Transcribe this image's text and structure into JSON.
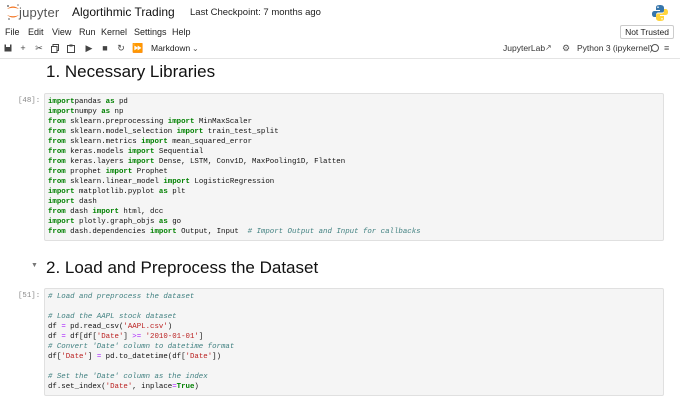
{
  "header": {
    "brand": "jupyter",
    "notebook_title": "Algortihmic Trading",
    "checkpoint": "Last Checkpoint: 7 months ago"
  },
  "menu": {
    "items": [
      "File",
      "Edit",
      "View",
      "Run",
      "Kernel",
      "Settings",
      "Help"
    ],
    "trust_label": "Not Trusted"
  },
  "toolbar": {
    "cell_type": "Markdown",
    "jupyterlab_label": "JupyterLab",
    "kernel_name": "Python 3 (ipykernel)"
  },
  "cells": {
    "heading1": "1. Necessary Libraries",
    "code1_prompt": "[48]:",
    "heading2": "2. Load and Preprocess the Dataset",
    "code2_prompt": "[51]:"
  },
  "code1_lines": [
    [
      [
        "kw",
        "import"
      ],
      [
        "",
        "pandas "
      ],
      [
        "kw",
        "as"
      ],
      [
        "",
        " pd"
      ]
    ],
    [
      [
        "kw",
        "import"
      ],
      [
        "",
        "numpy "
      ],
      [
        "kw",
        "as"
      ],
      [
        "",
        " np"
      ]
    ],
    [
      [
        "kw",
        "from"
      ],
      [
        "",
        " sklearn.preprocessing "
      ],
      [
        "kw",
        "import"
      ],
      [
        "",
        " MinMaxScaler"
      ]
    ],
    [
      [
        "kw",
        "from"
      ],
      [
        "",
        " sklearn.model_selection "
      ],
      [
        "kw",
        "import"
      ],
      [
        "",
        " train_test_split"
      ]
    ],
    [
      [
        "kw",
        "from"
      ],
      [
        "",
        " sklearn.metrics "
      ],
      [
        "kw",
        "import"
      ],
      [
        "",
        " mean_squared_error"
      ]
    ],
    [
      [
        "kw",
        "from"
      ],
      [
        "",
        " keras.models "
      ],
      [
        "kw",
        "import"
      ],
      [
        "",
        " Sequential"
      ]
    ],
    [
      [
        "kw",
        "from"
      ],
      [
        "",
        " keras.layers "
      ],
      [
        "kw",
        "import"
      ],
      [
        "",
        " Dense, LSTM, Conv1D, MaxPooling1D, Flatten"
      ]
    ],
    [
      [
        "kw",
        "from"
      ],
      [
        "",
        " prophet "
      ],
      [
        "kw",
        "import"
      ],
      [
        "",
        " Prophet"
      ]
    ],
    [
      [
        "kw",
        "from"
      ],
      [
        "",
        " sklearn.linear_model "
      ],
      [
        "kw",
        "import"
      ],
      [
        "",
        " LogisticRegression"
      ]
    ],
    [
      [
        "kw",
        "import"
      ],
      [
        "",
        " matplotlib.pyplot "
      ],
      [
        "kw",
        "as"
      ],
      [
        "",
        " plt"
      ]
    ],
    [
      [
        "kw",
        "import"
      ],
      [
        "",
        " dash"
      ]
    ],
    [
      [
        "kw",
        "from"
      ],
      [
        "",
        " dash "
      ],
      [
        "kw",
        "import"
      ],
      [
        "",
        " html, dcc"
      ]
    ],
    [
      [
        "kw",
        "import"
      ],
      [
        "",
        " plotly.graph_objs "
      ],
      [
        "kw",
        "as"
      ],
      [
        "",
        " go"
      ]
    ],
    [
      [
        "kw",
        "from"
      ],
      [
        "",
        " dash.dependencies "
      ],
      [
        "kw",
        "import"
      ],
      [
        "",
        " Output, Input  "
      ],
      [
        "cm",
        "# Import Output and Input for callbacks"
      ]
    ]
  ],
  "code2_lines": [
    [
      [
        "cm",
        "# Load and preprocess the dataset"
      ]
    ],
    [],
    [
      [
        "cm",
        "# Load the AAPL stock dataset"
      ]
    ],
    [
      [
        "",
        "df "
      ],
      [
        "op",
        "="
      ],
      [
        "",
        " pd.read_csv("
      ],
      [
        "str",
        "'AAPL.csv'"
      ],
      [
        "",
        ")"
      ]
    ],
    [
      [
        "",
        "df "
      ],
      [
        "op",
        "="
      ],
      [
        "",
        " df[df["
      ],
      [
        "str",
        "'Date'"
      ],
      [
        "",
        "] "
      ],
      [
        "op",
        ">="
      ],
      [
        "",
        " "
      ],
      [
        "str",
        "'2010-01-01'"
      ],
      [
        "",
        "]"
      ]
    ],
    [
      [
        "cm",
        "# Convert 'Date' column to datetime format"
      ]
    ],
    [
      [
        "",
        "df["
      ],
      [
        "str",
        "'Date'"
      ],
      [
        "",
        "] "
      ],
      [
        "op",
        "="
      ],
      [
        "",
        " pd.to_datetime(df["
      ],
      [
        "str",
        "'Date'"
      ],
      [
        "",
        "])"
      ]
    ],
    [],
    [
      [
        "cm",
        "# Set the 'Date' column as the index"
      ]
    ],
    [
      [
        "",
        "df.set_index("
      ],
      [
        "str",
        "'Date'"
      ],
      [
        "",
        ", inplace"
      ],
      [
        "op",
        "="
      ],
      [
        "kw",
        "True"
      ],
      [
        "",
        ")"
      ]
    ]
  ]
}
